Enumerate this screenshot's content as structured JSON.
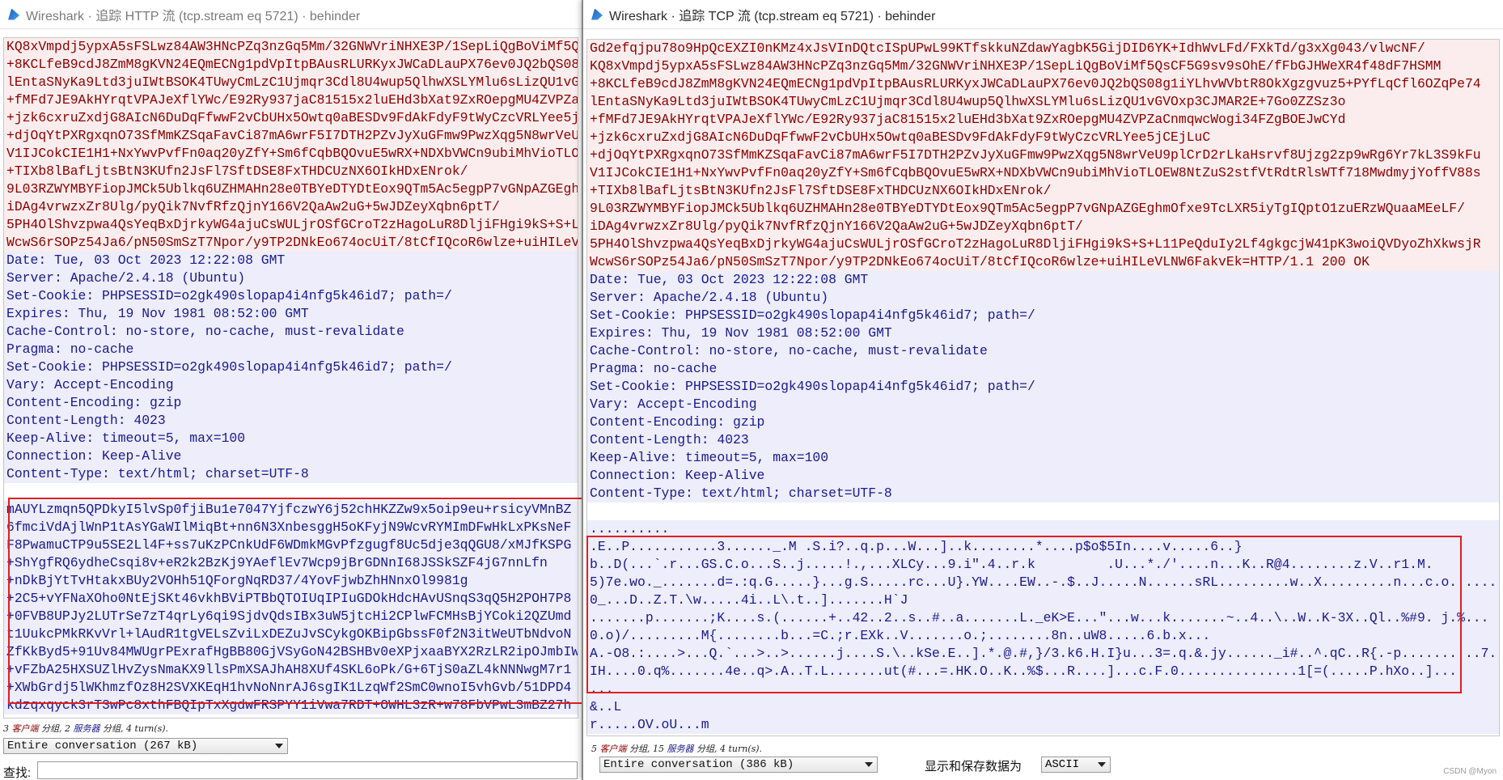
{
  "left": {
    "title": "Wireshark · 追踪 HTTP 流 (tcp.stream eq 5721) · behinder",
    "lines": [
      [
        "c",
        "KQ8xVmpdj5ypxA5sFSLwz84AW3HNcPZq3nzGq5Mm/32GNWVriNHXE3P/1SepLiQgBoViMf5QsCF5G9sv9sOhE/fFbGJHWeXR4f48dF7HSMM"
      ],
      [
        "c",
        "+8KCLfeB9cdJ8ZmM8gKVN24EQmECNg1pdVpItpBAusRLURKyxJWCaDLauPX76ev0JQ2bQS08g1iYLhvWVbtR8OkXgzgvuz5+PYfLqCfl6OZqPe74"
      ],
      [
        "c",
        "lEntaSNyKa9Ltd3juIWtBSOK4TUwyCmLzC1Ujmqr3Cdl8U4wup5QlhwXSLYMlu6sLizQU1vGVOxp3CJMAR2E+7Go0ZZSz3o"
      ],
      [
        "c",
        "+fMFd7JE9AkHYrqtVPAJeXflYWc/E92Ry937jaC81515x2luEHd3bXat9ZxROepgMU4ZVPZaCnmqwcWogi34FZgBOEJwCYd"
      ],
      [
        "c",
        "+jzk6cxruZxdjG8AIcN6DuDqFfwwF2vCbUHx5Owtq0aBESDv9FdAkFdyF9tWyCzcVRLYee5jCEjLuC"
      ],
      [
        "c",
        "+djOqYtPXRgxqnO73SfMmKZSqaFavCi87mA6wrF5I7DTH2PZvJyXuGFmw9PwzXqg5N8wrVeU9plCrD2rLkaHsrvf8Ujzg2zp9wRg6Yr7kL3S9kFu"
      ],
      [
        "c",
        "V1IJCokCIE1H1+NxYwvPvfFn0aq20yZfY+Sm6fCqbBQOvuE5wRX+NDXbVWCn9ubiMhVioTLOEW8NtZuS2stfVtRdtRlsWTf718MwdmyjYoffV88s"
      ],
      [
        "c",
        "+TIXb8lBafLjtsBtN3KUfn2JsFl7SftDSE8FxTHDCUzNX6OIkHDxENrok/"
      ],
      [
        "c",
        "9L03RZWYMBYFiopJMCk5Ublkq6UZHMAHn28e0TBYeDTYDtEox9QTm5Ac5egpP7vGNpAZGEghmOfxe9TcLXR5iyTgIQptO1zuERzWQuaaMEeLF/"
      ],
      [
        "c",
        "iDAg4vrwzxZr8Ulg/pyQik7NvfRfzQjnY166V2QaAw2uG+5wJDZeyXqbn6ptT/"
      ],
      [
        "c",
        "5PH4OlShvzpwa4QsYeqBxDjrkyWG4ajuCsWULjrOSfGCroT2zHagoLuR8DljiFHgi9kS+S+L11PeQduIy2Lf4gkgcjW41pK3woiQVDyoZhXkwsjR"
      ],
      [
        "c",
        "WcwS6rSOPz54Ja6/pN50SmSzT7Npor/y9TP2DNkEo674ocUiT/8tCfIQcoR6wlze+uiHILeVLNW6FakvEk="
      ],
      [
        "s",
        "Date: Tue, 03 Oct 2023 12:22:08 GMT"
      ],
      [
        "s",
        "Server: Apache/2.4.18 (Ubuntu)"
      ],
      [
        "s",
        "Set-Cookie: PHPSESSID=o2gk490slopap4i4nfg5k46id7; path=/"
      ],
      [
        "s",
        "Expires: Thu, 19 Nov 1981 08:52:00 GMT"
      ],
      [
        "s",
        "Cache-Control: no-store, no-cache, must-revalidate"
      ],
      [
        "s",
        "Pragma: no-cache"
      ],
      [
        "s",
        "Set-Cookie: PHPSESSID=o2gk490slopap4i4nfg5k46id7; path=/"
      ],
      [
        "s",
        "Vary: Accept-Encoding"
      ],
      [
        "s",
        "Content-Encoding: gzip"
      ],
      [
        "s",
        "Content-Length: 4023"
      ],
      [
        "s",
        "Keep-Alive: timeout=5, max=100"
      ],
      [
        "s",
        "Connection: Keep-Alive"
      ],
      [
        "s",
        "Content-Type: text/html; charset=UTF-8"
      ],
      [
        "g",
        ""
      ],
      [
        "s",
        "mAUYLzmqn5QPDkyI5lvSp0fjiBu1e7047YjfczwY6j52chHKZZw9x5oip9eu+rsicyVMnBZ"
      ],
      [
        "s",
        "6fmciVdAjlWnP1tAsYGaWIlMiqBt+nn6N3XnbesggH5oKFyjN9WcvRYMImDFwHkLxPKsNeF"
      ],
      [
        "s",
        "F8PwamuCTP9u5SE2Ll4F+ss7uKzPCnkUdF6WDmkMGvPfzgugf8Uc5dje3qQGU8/xMJfKSPG"
      ],
      [
        "s",
        "+ShYgfRQ6ydheCsqi8v+eR2k2BzKj9YAeflEv7Wcp9jBrGDNnI68JSSkSZF4jG7nnLfn"
      ],
      [
        "s",
        "+nDkBjYtTvHtakxBUy2VOHh51QForgNqRD37/4YovFjwbZhHNnxOl9981g"
      ],
      [
        "s",
        "+2C5+vYFNaXOho0NtEjSKt46vkhBViPTBbQTOIUqIPIuGDOkHdcHAvUSnqS3qQ5H2POH7P8"
      ],
      [
        "s",
        "+0FVB8UPJy2LUTrSe7zT4qrLy6qi9SjdvQdsIBx3uW5jtcHi2CPlwFCMHsBjYCoki2QZUmd"
      ],
      [
        "s",
        "t1UukcPMkRKvVrl+lAudR1tgVELsZviLxDEZuJvSCykgOKBipGbssF0f2N3itWeUTbNdvoN"
      ],
      [
        "s",
        "ZfKkByd5+91Uv84MWUgrPExrafHgBB80GjVSyGoN42BSHBv0eXPjxaaBYX2RzLR2ipOJmbIW"
      ],
      [
        "s",
        "+vFZbA25HXSUZlHvZysNmaKX9llsPmXSAJhAH8XUf4SKL6oPk/G+6TjS0aZL4kNNNwgM7r1"
      ],
      [
        "s",
        "+XWbGrdj5lWKhmzfOz8H2SVXKEqH1hvNoNnrAJ6sgIK1LzqWf2SmC0wnoI5vhGvb/51DPD4"
      ],
      [
        "s",
        "kdzqxqyck3rT3wPc8xthFBQIpTxXgdwFRSPYY1iVwa7RDT+OWHL3zR+w78FbVPwL3mBZ27h"
      ]
    ],
    "summary": {
      "prefix": "3 ",
      "client": "客户端",
      "mid": " 分组, 2 ",
      "server": "服务器",
      "suffix": " 分组, 4 turn(s)."
    },
    "conversation_select": "Entire conversation (267 kB)",
    "find_label": "查找:"
  },
  "right": {
    "title": "Wireshark · 追踪 TCP 流 (tcp.stream eq 5721) · behinder",
    "lines": [
      [
        "c",
        "Gd2efqjpu78o9HpQcEXZI0nKMz4xJsVInDQtcISpUPwL99KTfskkuNZdawYagbK5GijDID6YK+IdhWvLFd/FXkTd/g3xXg043/vlwcNF/"
      ],
      [
        "c",
        "KQ8xVmpdj5ypxA5sFSLwz84AW3HNcPZq3nzGq5Mm/32GNWVriNHXE3P/1SepLiQgBoViMf5QsCF5G9sv9sOhE/fFbGJHWeXR4f48dF7HSMM"
      ],
      [
        "c",
        "+8KCLfeB9cdJ8ZmM8gKVN24EQmECNg1pdVpItpBAusRLURKyxJWCaDLauPX76ev0JQ2bQS08g1iYLhvWVbtR8OkXgzgvuz5+PYfLqCfl6OZqPe74"
      ],
      [
        "c",
        "lEntaSNyKa9Ltd3juIWtBSOK4TUwyCmLzC1Ujmqr3Cdl8U4wup5QlhwXSLYMlu6sLizQU1vGVOxp3CJMAR2E+7Go0ZZSz3o"
      ],
      [
        "c",
        "+fMFd7JE9AkHYrqtVPAJeXflYWc/E92Ry937jaC81515x2luEHd3bXat9ZxROepgMU4ZVPZaCnmqwcWogi34FZgBOEJwCYd"
      ],
      [
        "c",
        "+jzk6cxruZxdjG8AIcN6DuDqFfwwF2vCbUHx5Owtq0aBESDv9FdAkFdyF9tWyCzcVRLYee5jCEjLuC"
      ],
      [
        "c",
        "+djOqYtPXRgxqnO73SfMmKZSqaFavCi87mA6wrF5I7DTH2PZvJyXuGFmw9PwzXqg5N8wrVeU9plCrD2rLkaHsrvf8Ujzg2zp9wRg6Yr7kL3S9kFu"
      ],
      [
        "c",
        "V1IJCokCIE1H1+NxYwvPvfFn0aq20yZfY+Sm6fCqbBQOvuE5wRX+NDXbVWCn9ubiMhVioTLOEW8NtZuS2stfVtRdtRlsWTf718MwdmyjYoffV88s"
      ],
      [
        "c",
        "+TIXb8lBafLjtsBtN3KUfn2JsFl7SftDSE8FxTHDCUzNX6OIkHDxENrok/"
      ],
      [
        "c",
        "9L03RZWYMBYFiopJMCk5Ublkq6UZHMAHn28e0TBYeDTYDtEox9QTm5Ac5egpP7vGNpAZGEghmOfxe9TcLXR5iyTgIQptO1zuERzWQuaaMEeLF/"
      ],
      [
        "c",
        "iDAg4vrwzxZr8Ulg/pyQik7NvfRfzQjnY166V2QaAw2uG+5wJDZeyXqbn6ptT/"
      ],
      [
        "c",
        "5PH4OlShvzpwa4QsYeqBxDjrkyWG4ajuCsWULjrOSfGCroT2zHagoLuR8DljiFHgi9kS+S+L11PeQduIy2Lf4gkgcjW41pK3woiQVDyoZhXkwsjR"
      ],
      [
        "c",
        "WcwS6rSOPz54Ja6/pN50SmSzT7Npor/y9TP2DNkEo674ocUiT/8tCfIQcoR6wlze+uiHILeVLNW6FakvEk=HTTP/1.1 200 OK"
      ],
      [
        "s",
        "Date: Tue, 03 Oct 2023 12:22:08 GMT"
      ],
      [
        "s",
        "Server: Apache/2.4.18 (Ubuntu)"
      ],
      [
        "s",
        "Set-Cookie: PHPSESSID=o2gk490slopap4i4nfg5k46id7; path=/"
      ],
      [
        "s",
        "Expires: Thu, 19 Nov 1981 08:52:00 GMT"
      ],
      [
        "s",
        "Cache-Control: no-store, no-cache, must-revalidate"
      ],
      [
        "s",
        "Pragma: no-cache"
      ],
      [
        "s",
        "Set-Cookie: PHPSESSID=o2gk490slopap4i4nfg5k46id7; path=/"
      ],
      [
        "s",
        "Vary: Accept-Encoding"
      ],
      [
        "s",
        "Content-Encoding: gzip"
      ],
      [
        "s",
        "Content-Length: 4023"
      ],
      [
        "s",
        "Keep-Alive: timeout=5, max=100"
      ],
      [
        "s",
        "Connection: Keep-Alive"
      ],
      [
        "s",
        "Content-Type: text/html; charset=UTF-8"
      ],
      [
        "g",
        ""
      ],
      [
        "s",
        ".........."
      ],
      [
        "s",
        ".E..P...........3......_.M .S.i?..q.p...W...]..k........*....p$o$5In....v.....6..}"
      ],
      [
        "s",
        "b..D(...`.r...GS.C.o...S..j.....!.,...XLCy...9.i\".4..r.k         .U...*./'....n...K..R@4........z.V..r1.M."
      ],
      [
        "s",
        "5)7e.wo._.......d=.:q.G.....}...g.S.....rc...U}.YW....EW..-.$..J.....N......sRL.........w..X.........n...c.o.............#."
      ],
      [
        "s",
        "0_...D..Z.T.\\w.....4i..L\\.t..].......H`J"
      ],
      [
        "s",
        ".......p.......;K....s.(......+..42..2..s..#..a.......L._eK>E...\"...w...k.......~..4..\\..W..K-3X..Ql..%#9. j.%..."
      ],
      [
        "s",
        "0.o)/.........M{........b...=C.;r.EXk..V.......o.;........8n..uW8.....6.b.x..."
      ],
      [
        "s",
        "A.-O8.:....>...Q.`...>..>......j....S.\\..kSe.E..].*.@.#,}/3.k6.H.I}u...3=.q.&.jy......_i#..^.qC..R{.-p..........7.."
      ],
      [
        "s",
        "IH....0.q%.......4e..q>.A..T.L.......ut(#...=.HK.O..K..%$...R....]...c.F.0...............1[=(.....P.hXo..]..."
      ],
      [
        "s",
        "..."
      ],
      [
        "s",
        "&..L"
      ],
      [
        "s",
        "r.....OV.oU...m"
      ]
    ],
    "summary": {
      "prefix": "5 ",
      "client": "客户端",
      "mid": " 分组, 15 ",
      "server": "服务器",
      "suffix": " 分组, 4 turn(s)."
    },
    "conversation_select": "Entire conversation (386 kB)",
    "mode_label": "显示和保存数据为",
    "mode_select": "ASCII",
    "watermark": "CSDN @Myon⁠⁠"
  }
}
